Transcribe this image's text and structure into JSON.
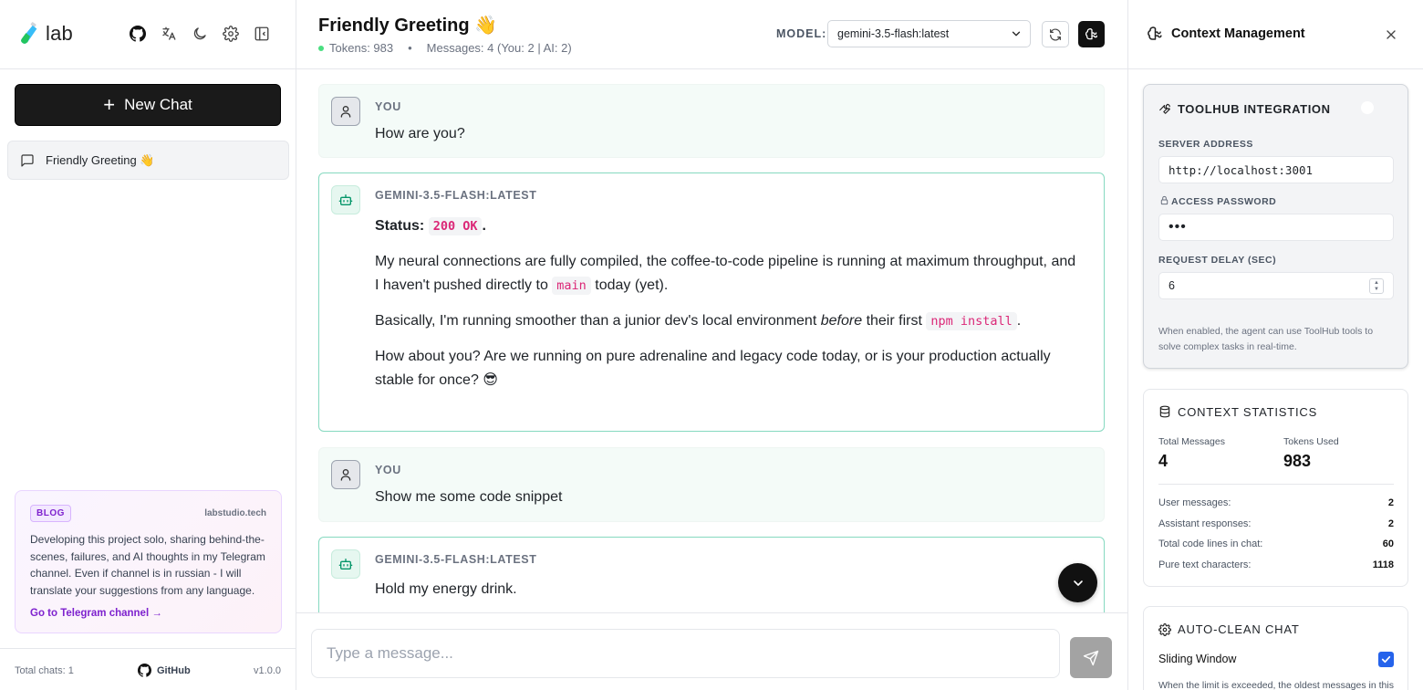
{
  "sidebar": {
    "logo_text": "lab",
    "new_chat_label": "New Chat",
    "chat_items": [
      {
        "title": "Friendly Greeting 👋"
      }
    ],
    "blog": {
      "badge": "BLOG",
      "site": "labstudio.tech",
      "text": "Developing this project solo, sharing behind-the-scenes, failures, and AI thoughts in my Telegram channel. Even if channel is in russian - I will translate your suggestions from any language.",
      "link": "Go to Telegram channel →"
    },
    "footer": {
      "total_chats": "Total chats: 1",
      "github": "GitHub",
      "version": "v1.0.0"
    }
  },
  "header": {
    "title": "Friendly Greeting 👋",
    "tokens": "Tokens: 983",
    "messages": "Messages: 4 (You: 2 | AI: 2)",
    "model_label": "MODEL:",
    "model_value": "gemini-3.5-flash:latest"
  },
  "messages": [
    {
      "role": "YOU",
      "text": "How are you?"
    },
    {
      "role": "GEMINI-3.5-FLASH:LATEST",
      "status_label": "Status:",
      "status_code": "200 OK",
      "status_end": ".",
      "p2_a": "My neural connections are fully compiled, the coffee-to-code pipeline is running at maximum throughput, and I haven't pushed directly to",
      "p2_code": "main",
      "p2_b": "today (yet).",
      "p3_a": "Basically, I'm running smoother than a junior dev's local environment",
      "p3_em": "before",
      "p3_b": "their first",
      "p3_code": "npm install",
      "p3_c": ".",
      "p4": "How about you? Are we running on pure adrenaline and legacy code today, or is your production actually stable for once? 😎"
    },
    {
      "role": "YOU",
      "text": "Show me some code snippet"
    },
    {
      "role": "GEMINI-3.5-FLASH:LATEST",
      "text": "Hold my energy drink."
    }
  ],
  "composer": {
    "placeholder": "Type a message..."
  },
  "context_panel": {
    "title": "Context Management",
    "toolhub": {
      "title": "TOOLHUB INTEGRATION",
      "enabled": false,
      "server_label": "SERVER ADDRESS",
      "server_value": "http://localhost:3001",
      "password_label": "ACCESS PASSWORD",
      "password_value": "•••",
      "delay_label": "REQUEST DELAY (SEC)",
      "delay_value": "6",
      "help": "When enabled, the agent can use ToolHub tools to solve complex tasks in real-time."
    },
    "stats": {
      "title": "CONTEXT STATISTICS",
      "total_messages_label": "Total Messages",
      "total_messages": "4",
      "tokens_used_label": "Tokens Used",
      "tokens_used": "983",
      "rows": [
        {
          "label": "User messages:",
          "value": "2"
        },
        {
          "label": "Assistant responses:",
          "value": "2"
        },
        {
          "label": "Total code lines in chat:",
          "value": "60"
        },
        {
          "label": "Pure text characters:",
          "value": "1118"
        }
      ]
    },
    "autoclean": {
      "title": "AUTO-CLEAN CHAT",
      "sliding_window_label": "Sliding Window",
      "sliding_window_checked": true,
      "help": "When the limit is exceeded, the oldest messages in this"
    }
  },
  "colors": {
    "accent_green": "#86d9c0",
    "code_pink": "#db2777",
    "checkbox_blue": "#2563eb",
    "blog_purple": "#7e22ce"
  }
}
